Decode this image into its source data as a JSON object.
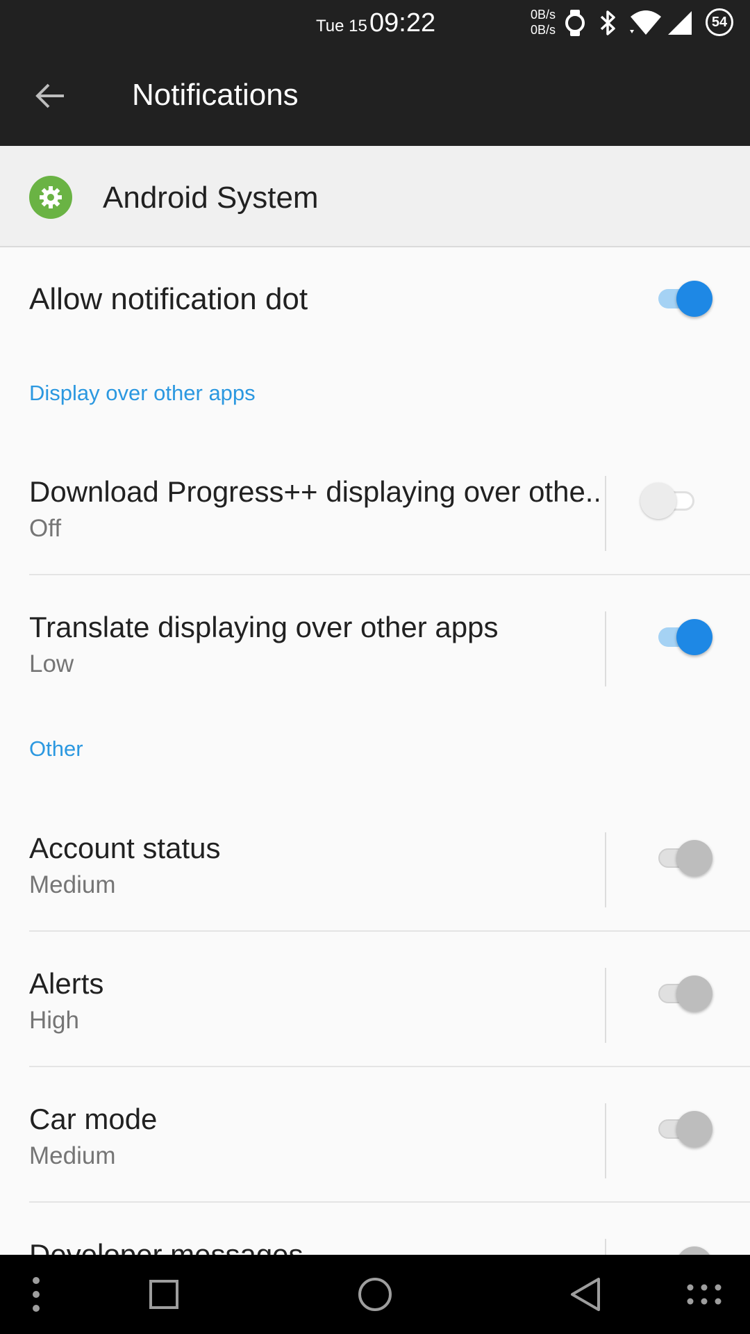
{
  "status_bar": {
    "date": "Tue 15",
    "time": "09:22",
    "upload_speed": "0B/s",
    "download_speed": "0B/s",
    "battery_level": "54",
    "icons": [
      "watch-icon",
      "bluetooth-icon",
      "wifi-icon",
      "cell-signal-icon",
      "battery-icon"
    ]
  },
  "app_bar": {
    "title": "Notifications"
  },
  "app_header": {
    "app_name": "Android System",
    "icon": "gear-icon",
    "icon_color": "#6ab344"
  },
  "notification_dot": {
    "label": "Allow notification dot",
    "enabled": true
  },
  "sections": [
    {
      "header": "Display over other apps",
      "channels": [
        {
          "title": "Download Progress++ displaying over othe..",
          "summary": "Off",
          "enabled": false
        },
        {
          "title": "Translate displaying over other apps",
          "summary": "Low",
          "enabled": true
        }
      ]
    },
    {
      "header": "Other",
      "channels": [
        {
          "title": "Account status",
          "summary": "Medium",
          "enabled": true
        },
        {
          "title": "Alerts",
          "summary": "High",
          "enabled": true
        },
        {
          "title": "Car mode",
          "summary": "Medium",
          "enabled": true
        },
        {
          "title": "Developer messages",
          "summary": "",
          "enabled": true
        }
      ]
    }
  ],
  "colors": {
    "accent": "#1e88e5",
    "section_header": "#2b98e0",
    "toolbar": "#212121"
  },
  "nav_bar": {
    "icons": [
      "more-vertical-icon",
      "recents-icon",
      "home-icon",
      "back-icon",
      "more-horizontal-icon"
    ]
  }
}
